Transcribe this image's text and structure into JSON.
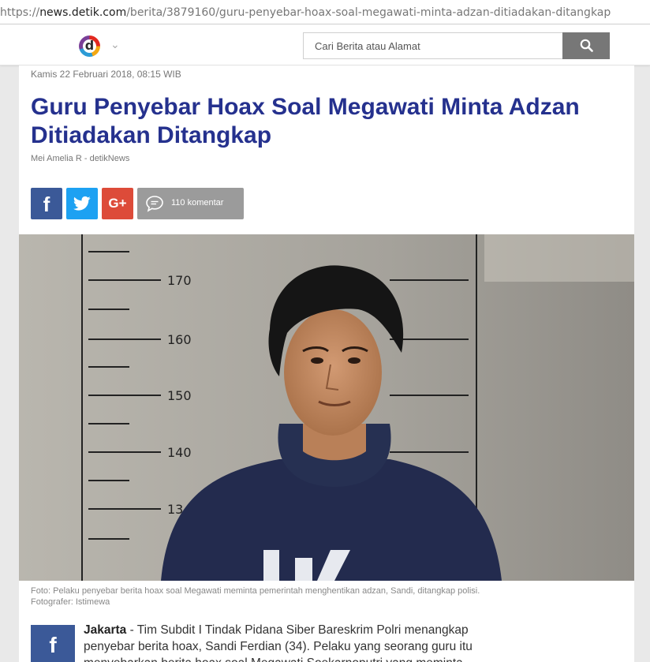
{
  "browser": {
    "url_prefix": "https://",
    "url_host": "news.detik.com",
    "url_path": "/berita/3879160/guru-penyebar-hoax-soal-megawati-minta-adzan-ditiadakan-ditangkap"
  },
  "header": {
    "logo_text": "d",
    "search_placeholder": "Cari Berita atau Alamat"
  },
  "article": {
    "date": "Kamis 22 Februari 2018, 08:15 WIB",
    "title": "Guru Penyebar Hoax Soal Megawati Minta Adzan Ditiadakan Ditangkap",
    "author": "Mei Amelia R - detikNews",
    "share": {
      "facebook_glyph": "f",
      "google_glyph": "G+",
      "comments_label": "110 komentar"
    },
    "photo": {
      "ruler_labels": [
        "170",
        "160",
        "150",
        "140",
        "13"
      ]
    },
    "caption_line1": "Foto: Pelaku penyebar berita hoax soal Megawati meminta pemerintah menghentikan adzan, Sandi, ditangkap polisi.",
    "caption_line2": "Fotografer: Istimewa",
    "lead_city": "Jakarta",
    "lead_text": " - Tim Subdit I Tindak Pidana Siber Bareskrim Polri menangkap penyebar berita hoax, Sandi Ferdian (34). Pelaku yang seorang guru itu menyebarkan berita hoax soal Megawati Soekarnoputri yang meminta"
  },
  "colors": {
    "title": "#25318e",
    "facebook": "#3b5998",
    "twitter": "#1da1f2",
    "google_plus": "#dd4b39",
    "comments": "#9b9b9b",
    "search_button": "#777777"
  }
}
